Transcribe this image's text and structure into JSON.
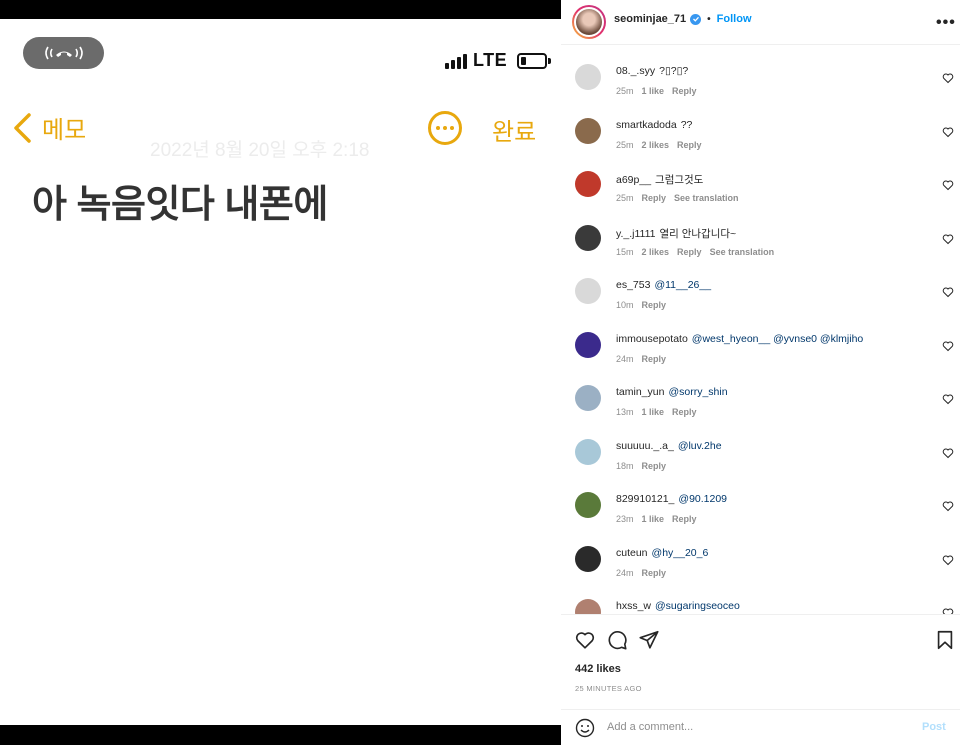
{
  "phone": {
    "network": "LTE",
    "memo_back_label": "메모",
    "done_label": "완료",
    "memo_date": "2022년 8월 20일 오후 2:18",
    "memo_body": "아 녹음잇다 내폰에"
  },
  "post": {
    "username": "seominjae_71",
    "separator": "•",
    "follow_label": "Follow",
    "more_label": "•••",
    "likes": "442 likes",
    "time_ago": "25 MINUTES AGO",
    "comment_placeholder": "Add a comment...",
    "post_label": "Post"
  },
  "comments": [
    {
      "user": "08._.syy",
      "text": "?▯?▯?",
      "time": "25m",
      "likes": "1 like",
      "reply": "Reply",
      "translate": "",
      "avatar": "#d9d9d9"
    },
    {
      "user": "smartkadoda",
      "text": "??",
      "time": "25m",
      "likes": "2 likes",
      "reply": "Reply",
      "translate": "",
      "avatar": "#8a6a4c"
    },
    {
      "user": "a69p__",
      "text": "그럼그것도",
      "time": "25m",
      "likes": "",
      "reply": "Reply",
      "translate": "See translation",
      "avatar": "#c0392b"
    },
    {
      "user": "y._.j1111",
      "text": "열리 안나갑니다~",
      "time": "15m",
      "likes": "2 likes",
      "reply": "Reply",
      "translate": "See translation",
      "avatar": "#3a3a3a"
    },
    {
      "user": "es_753",
      "text": "@11__26__",
      "time": "10m",
      "likes": "",
      "reply": "Reply",
      "translate": "",
      "avatar": "#d9d9d9"
    },
    {
      "user": "immousepotato",
      "text": "@west_hyeon__ @yvnse0 @klmjiho",
      "time": "24m",
      "likes": "",
      "reply": "Reply",
      "translate": "",
      "avatar": "#3b2a8c"
    },
    {
      "user": "tamin_yun",
      "text": "@sorry_shin",
      "time": "13m",
      "likes": "1 like",
      "reply": "Reply",
      "translate": "",
      "avatar": "#9bb0c4"
    },
    {
      "user": "suuuuu._.a_",
      "text": "@luv.2he",
      "time": "18m",
      "likes": "",
      "reply": "Reply",
      "translate": "",
      "avatar": "#a8c8d8"
    },
    {
      "user": "829910121_",
      "text": "@90.1209",
      "time": "23m",
      "likes": "1 like",
      "reply": "Reply",
      "translate": "",
      "avatar": "#5a7a3a"
    },
    {
      "user": "cuteun",
      "text": "@hy__20_6",
      "time": "24m",
      "likes": "",
      "reply": "Reply",
      "translate": "",
      "avatar": "#2a2a2a"
    },
    {
      "user": "hxss_w",
      "text": "@sugaringseoceo",
      "time": "",
      "likes": "",
      "reply": "",
      "translate": "",
      "avatar": "#b08070"
    }
  ]
}
